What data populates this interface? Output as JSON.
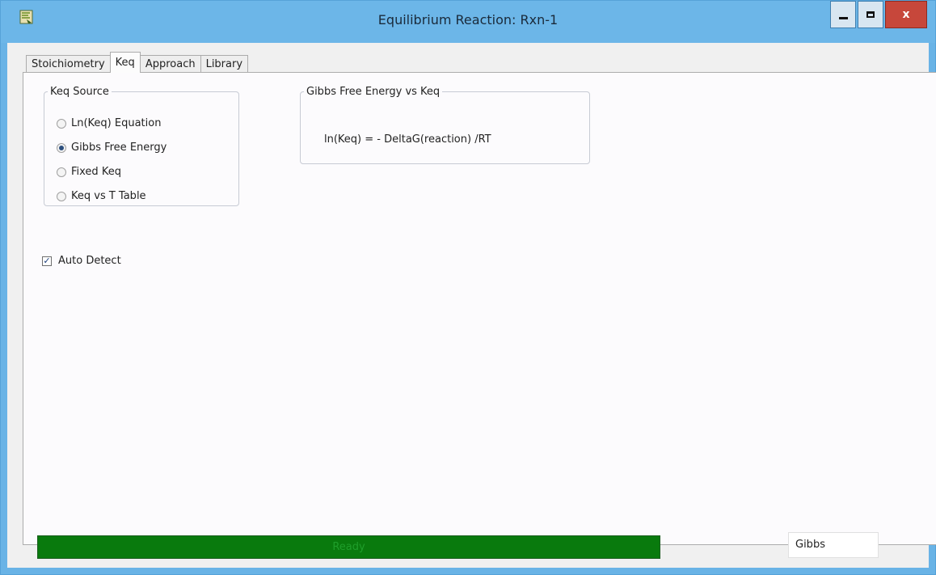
{
  "window": {
    "title": "Equilibrium Reaction: Rxn-1",
    "controls": {
      "minimize_icon": "minimize-icon",
      "maximize_icon": "maximize-icon",
      "close_label": "x"
    }
  },
  "tabs": [
    {
      "label": "Stoichiometry",
      "active": false
    },
    {
      "label": "Keq",
      "active": true
    },
    {
      "label": "Approach",
      "active": false
    },
    {
      "label": "Library",
      "active": false
    }
  ],
  "keq_source": {
    "title": "Keq Source",
    "options": [
      {
        "label": "Ln(Keq) Equation",
        "selected": false
      },
      {
        "label": "Gibbs Free Energy",
        "selected": true
      },
      {
        "label": "Fixed Keq",
        "selected": false
      },
      {
        "label": "Keq vs T Table",
        "selected": false
      }
    ]
  },
  "gibbs_group": {
    "title": "Gibbs Free Energy vs Keq",
    "formula": "ln(Keq) = - DeltaG(reaction) /RT"
  },
  "auto_detect": {
    "label": "Auto Detect",
    "checked": true
  },
  "status": {
    "text": "Ready",
    "bar_color": "#097a0d"
  },
  "mode_field": {
    "value": "Gibbs"
  }
}
